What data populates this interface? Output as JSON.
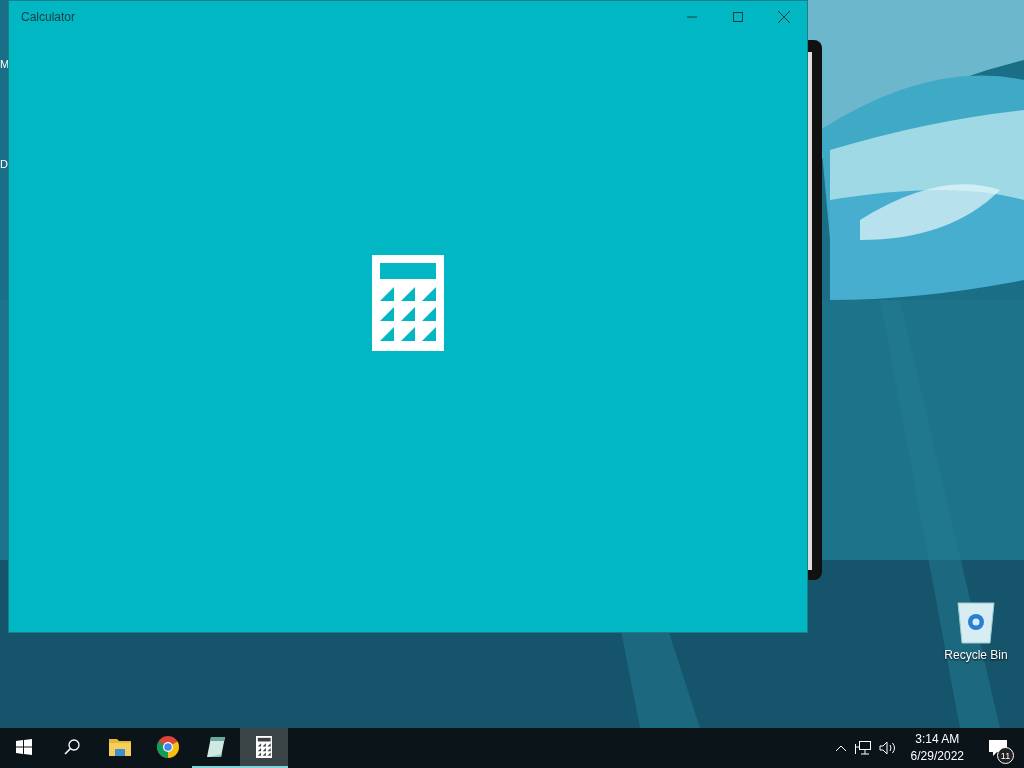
{
  "desktop": {
    "edge_labels": [
      "M",
      "D"
    ],
    "icons": [
      {
        "label": "Recycle Bin"
      }
    ]
  },
  "window": {
    "title": "Calculator"
  },
  "taskbar": {
    "apps": [
      {
        "kind": "start",
        "selected": false,
        "running": false
      },
      {
        "kind": "search",
        "selected": false,
        "running": false
      },
      {
        "kind": "folder",
        "selected": false,
        "running": false
      },
      {
        "kind": "browser",
        "selected": false,
        "running": false
      },
      {
        "kind": "notepad",
        "selected": false,
        "running": true
      },
      {
        "kind": "calculator",
        "selected": true,
        "running": true
      }
    ],
    "clock": {
      "time": "3:14 AM",
      "date": "6/29/2022"
    },
    "notifications": {
      "count": "11"
    }
  }
}
